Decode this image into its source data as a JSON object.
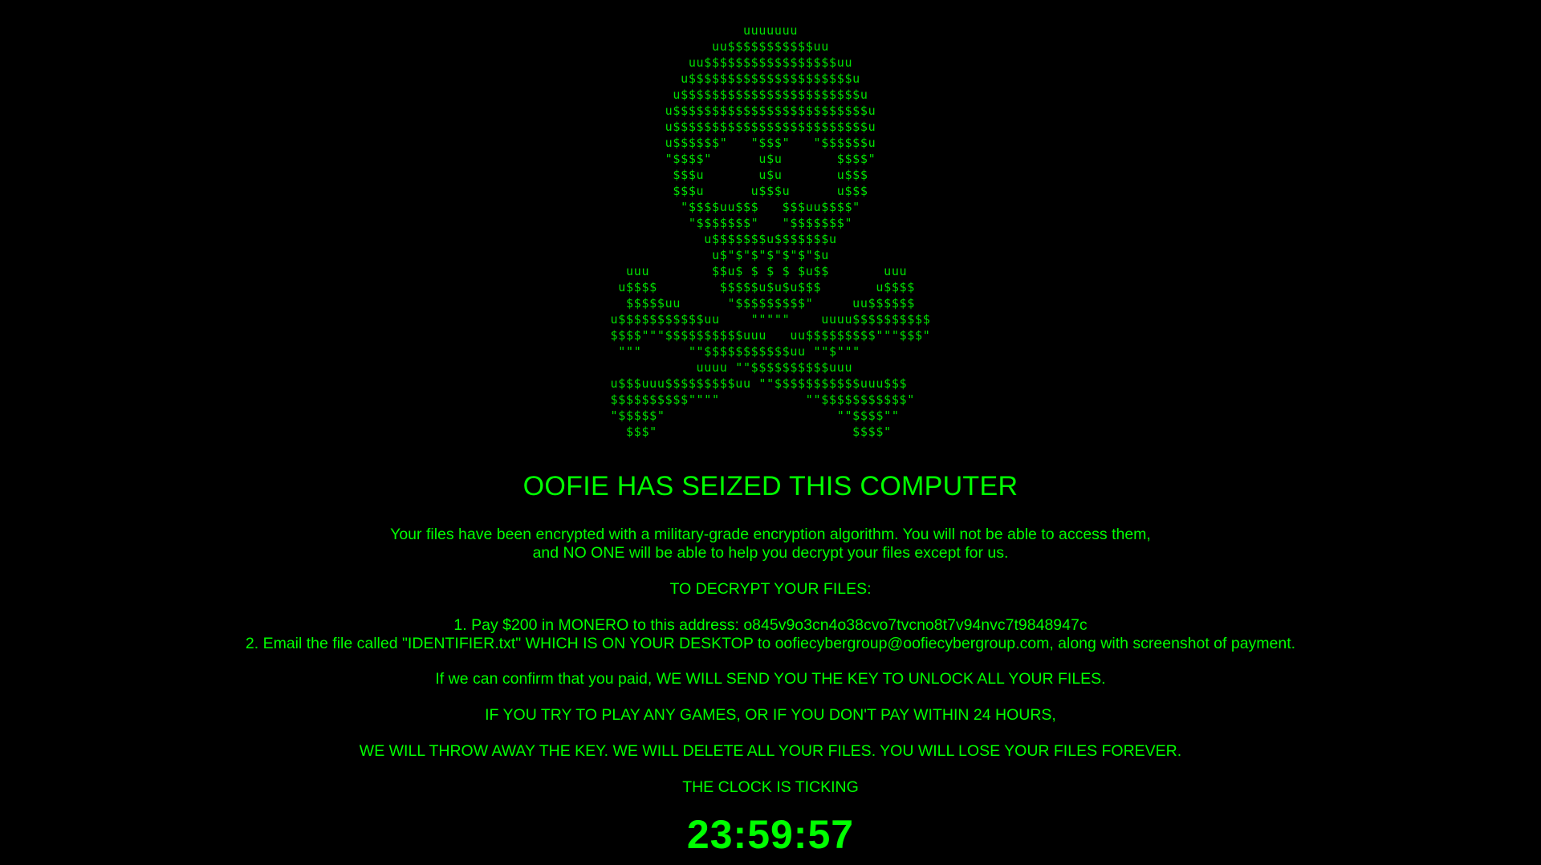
{
  "ascii_art": "                 uuuuuuu\n             uu$$$$$$$$$$$uu\n          uu$$$$$$$$$$$$$$$$$uu\n         u$$$$$$$$$$$$$$$$$$$$$u\n        u$$$$$$$$$$$$$$$$$$$$$$$u\n       u$$$$$$$$$$$$$$$$$$$$$$$$$u\n       u$$$$$$$$$$$$$$$$$$$$$$$$$u\n       u$$$$$$\"   \"$$$\"   \"$$$$$$u\n       \"$$$$\"      u$u       $$$$\"\n        $$$u       u$u       u$$$\n        $$$u      u$$$u      u$$$\n         \"$$$$uu$$$   $$$uu$$$$\"\n          \"$$$$$$$\"   \"$$$$$$$\"\n            u$$$$$$$u$$$$$$$u\n             u$\"$\"$\"$\"$\"$\"$u\n  uuu        $$u$ $ $ $ $u$$       uuu\n u$$$$        $$$$$u$u$u$$$       u$$$$\n  $$$$$uu      \"$$$$$$$$$\"     uu$$$$$$\nu$$$$$$$$$$$uu    \"\"\"\"\"    uuuu$$$$$$$$$$\n$$$$\"\"\"$$$$$$$$$$uuu   uu$$$$$$$$$\"\"\"$$$\"\n \"\"\"      \"\"$$$$$$$$$$$uu \"\"$\"\"\"\n           uuuu \"\"$$$$$$$$$$uuu\nu$$$uuu$$$$$$$$$uu \"\"$$$$$$$$$$$uuu$$$\n$$$$$$$$$$\"\"\"\"           \"\"$$$$$$$$$$$\"\n\"$$$$$\"                      \"\"$$$$\"\"\n  $$$\"                         $$$$\"",
  "title": "OOFIE HAS SEIZED THIS COMPUTER",
  "intro": {
    "line1": "Your files have been encrypted with a military-grade encryption algorithm. You will not be able to access them,",
    "line2": "and NO ONE will be able to help you decrypt your files except for us."
  },
  "instructions": {
    "heading": "TO DECRYPT YOUR FILES:",
    "step1": "1. Pay $200 in MONERO to this address: o845v9o3cn4o38cvo7tvcno8t7v94nvc7t9848947c",
    "step2": "2. Email the file called \"IDENTIFIER.txt\" WHICH IS ON YOUR DESKTOP to oofiecybergroup@oofiecybergroup.com, along with screenshot of payment."
  },
  "confirm": "If we can confirm that you paid, WE WILL SEND YOU THE KEY TO UNLOCK ALL YOUR FILES.",
  "warning1": "IF YOU TRY TO PLAY ANY GAMES, OR IF YOU DON'T PAY WITHIN 24 HOURS,",
  "warning2": "WE WILL THROW AWAY THE KEY. WE WILL DELETE ALL YOUR FILES. YOU WILL LOSE YOUR FILES FOREVER.",
  "ticking": "THE CLOCK IS TICKING",
  "countdown": "23:59:57",
  "colors": {
    "background": "#000000",
    "text": "#00ff00"
  }
}
